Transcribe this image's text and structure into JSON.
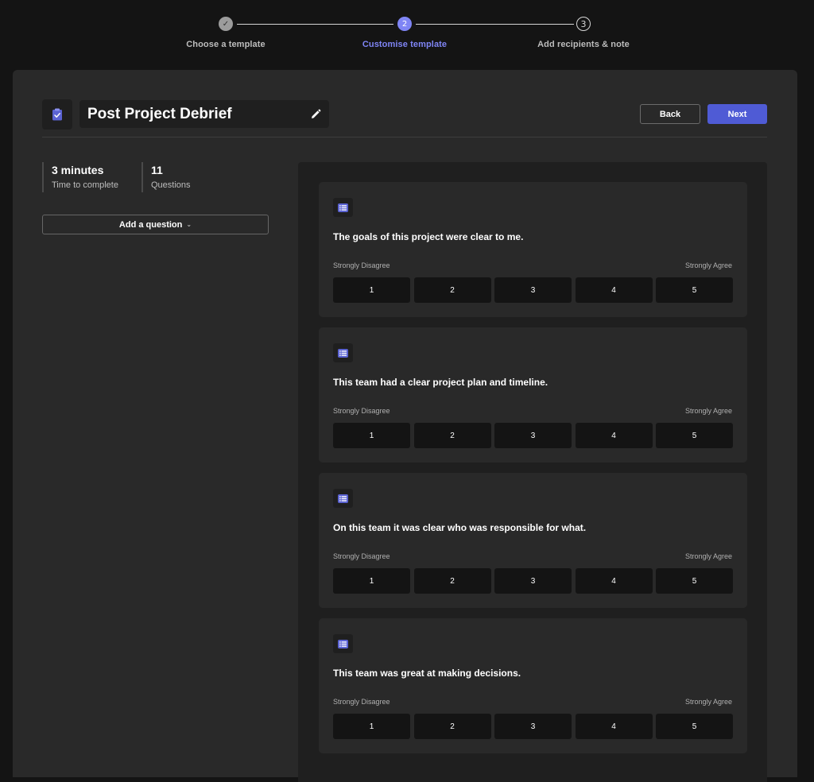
{
  "stepper": {
    "steps": [
      {
        "label": "Choose a template",
        "number": "✓",
        "state": "done"
      },
      {
        "label": "Customise template",
        "number": "2",
        "state": "active"
      },
      {
        "label": "Add recipients & note",
        "number": "3",
        "state": "todo"
      }
    ]
  },
  "header": {
    "title": "Post Project Debrief",
    "back_label": "Back",
    "next_label": "Next"
  },
  "stats": {
    "time_value": "3 minutes",
    "time_label": "Time to complete",
    "questions_value": "11",
    "questions_label": "Questions"
  },
  "add_question": {
    "label": "Add a question",
    "chevron": "⌄"
  },
  "questions": [
    {
      "text": "The goals of this project were clear to me.",
      "min_label": "Strongly Disagree",
      "max_label": "Strongly Agree",
      "options": [
        "1",
        "2",
        "3",
        "4",
        "5"
      ]
    },
    {
      "text": "This team had a clear project plan and timeline.",
      "min_label": "Strongly Disagree",
      "max_label": "Strongly Agree",
      "options": [
        "1",
        "2",
        "3",
        "4",
        "5"
      ]
    },
    {
      "text": "On this team it was clear who was responsible for what.",
      "min_label": "Strongly Disagree",
      "max_label": "Strongly Agree",
      "options": [
        "1",
        "2",
        "3",
        "4",
        "5"
      ]
    },
    {
      "text": "This team was great at making decisions.",
      "min_label": "Strongly Disagree",
      "max_label": "Strongly Agree",
      "options": [
        "1",
        "2",
        "3",
        "4",
        "5"
      ]
    }
  ],
  "colors": {
    "accent": "#7f85f5",
    "primary_button": "#4f5bd5",
    "background": "#141414",
    "panel": "#292929",
    "surface": "#1f1f1f"
  },
  "icons": {
    "header": "clipboard-check-icon",
    "edit": "pencil-icon",
    "question": "rating-scale-icon"
  }
}
